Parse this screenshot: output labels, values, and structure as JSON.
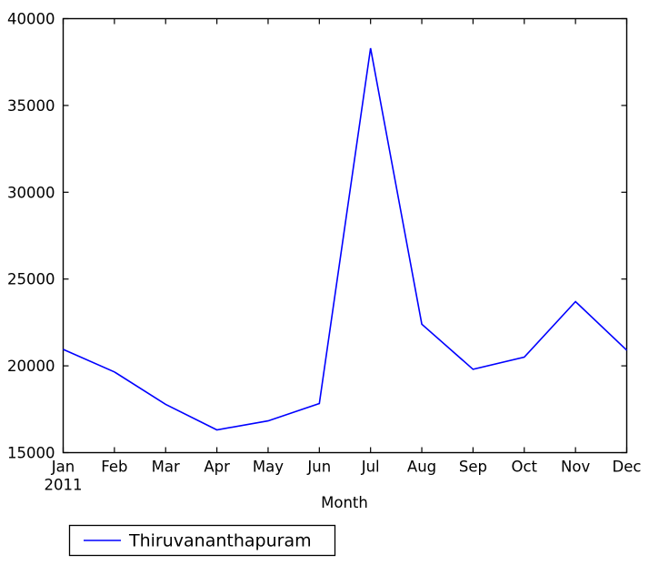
{
  "chart_data": {
    "type": "line",
    "title": "",
    "xlabel": "Month",
    "ylabel": "",
    "categories": [
      "Jan",
      "Feb",
      "Mar",
      "Apr",
      "May",
      "Jun",
      "Jul",
      "Aug",
      "Sep",
      "Oct",
      "Nov",
      "Dec"
    ],
    "x_sub_label": "2011",
    "series": [
      {
        "name": "Thiruvananthapuram",
        "color": "#0000ff",
        "values": [
          20950,
          19650,
          17780,
          16310,
          16830,
          17830,
          38300,
          22400,
          19800,
          20500,
          23700,
          20900
        ]
      }
    ],
    "ylim": [
      15000,
      40000
    ],
    "y_ticks": [
      "15000",
      "20000",
      "25000",
      "30000",
      "35000",
      "40000"
    ],
    "y_tick_values": [
      15000,
      20000,
      25000,
      30000,
      35000,
      40000
    ],
    "grid": false,
    "legend_position": "below-center",
    "legend_entries": [
      "Thiruvananthapuram"
    ]
  },
  "axes": {
    "x_axis_label": "Month",
    "x_tick_labels": [
      "Jan",
      "Feb",
      "Mar",
      "Apr",
      "May",
      "Jun",
      "Jul",
      "Aug",
      "Sep",
      "Oct",
      "Nov",
      "Dec"
    ],
    "x_tick_sublabel": "2011",
    "y_tick_labels": [
      "15000",
      "20000",
      "25000",
      "30000",
      "35000",
      "40000"
    ]
  },
  "legend": {
    "entries": [
      {
        "label": "Thiruvananthapuram",
        "color": "#0000ff"
      }
    ]
  },
  "colors": {
    "line": "#0000ff",
    "axis": "#000000",
    "background": "#ffffff"
  }
}
